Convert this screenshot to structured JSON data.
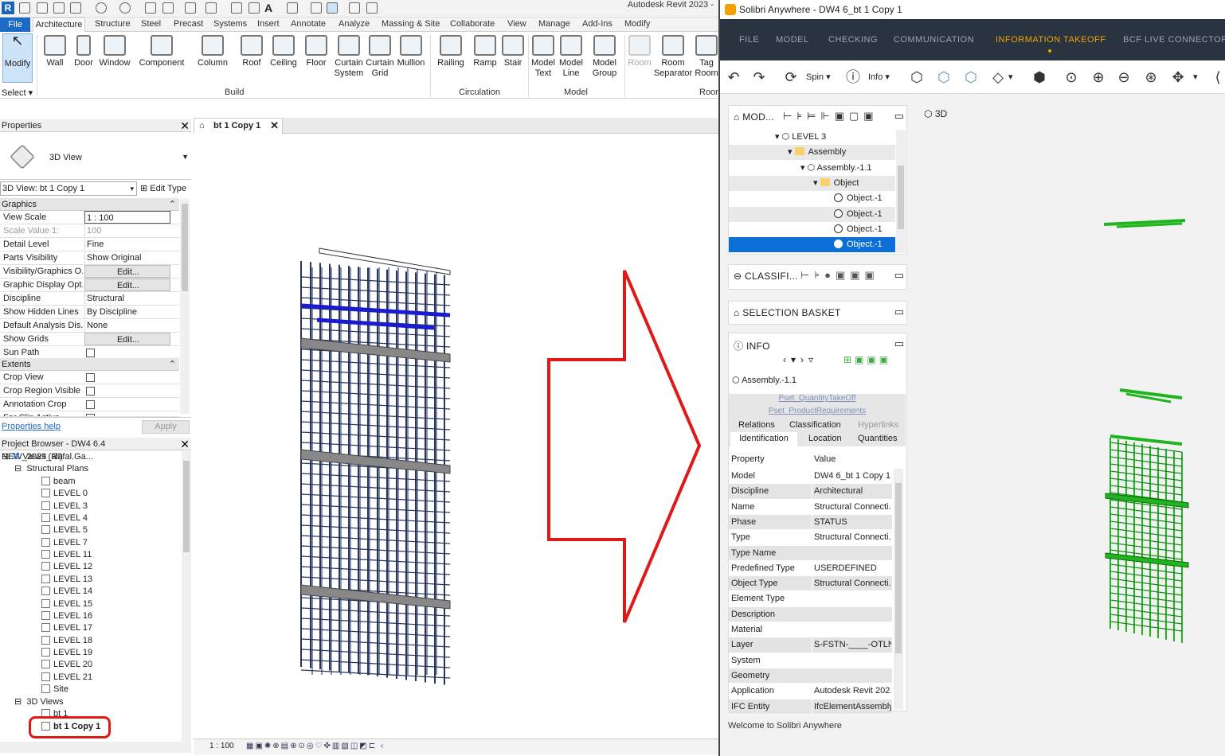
{
  "revit": {
    "title": "Autodesk Revit 2023 -",
    "tabs": [
      "File",
      "Architecture",
      "Structure",
      "Steel",
      "Precast",
      "Systems",
      "Insert",
      "Annotate",
      "Analyze",
      "Massing & Site",
      "Collaborate",
      "View",
      "Manage",
      "Add-Ins",
      "Modify"
    ],
    "ribbon": {
      "modify": "Modify",
      "select": "Select",
      "build": [
        "Wall",
        "Door",
        "Window",
        "Component",
        "Column",
        "Roof",
        "Ceiling",
        "Floor",
        "Curtain System",
        "Curtain Grid",
        "Mullion"
      ],
      "circulation": [
        "Railing",
        "Ramp",
        "Stair"
      ],
      "model": [
        "Model Text",
        "Model Line",
        "Model Group"
      ],
      "room": [
        "Room",
        "Room Separator",
        "Tag Room"
      ],
      "panels": {
        "build": "Build",
        "circulation": "Circulation",
        "model": "Model",
        "room": "Room"
      }
    },
    "properties": {
      "header": "Properties",
      "type": "3D View",
      "view_selector": "3D View: bt 1 Copy 1",
      "edit_type": "Edit Type",
      "group_graphics": "Graphics",
      "rows": [
        {
          "k": "View Scale",
          "v": "1 : 100"
        },
        {
          "k": "Scale Value    1:",
          "v": "100"
        },
        {
          "k": "Detail Level",
          "v": "Fine"
        },
        {
          "k": "Parts Visibility",
          "v": "Show Original"
        },
        {
          "k": "Visibility/Graphics O...",
          "v": "Edit..."
        },
        {
          "k": "Graphic Display Opt...",
          "v": "Edit..."
        },
        {
          "k": "Discipline",
          "v": "Structural"
        },
        {
          "k": "Show Hidden Lines",
          "v": "By Discipline"
        },
        {
          "k": "Default Analysis Dis...",
          "v": "None"
        },
        {
          "k": "Show Grids",
          "v": "Edit..."
        },
        {
          "k": "Sun Path",
          "v": ""
        }
      ],
      "group_extents": "Extents",
      "extent_rows": [
        {
          "k": "Crop View"
        },
        {
          "k": "Crop Region Visible"
        },
        {
          "k": "Annotation Crop"
        },
        {
          "k": "Far Clip Active"
        }
      ],
      "help": "Properties help",
      "apply": "Apply"
    },
    "browser": {
      "header": "Project Browser - DW4 6.4 NEW_2023_Rafal.Ga...",
      "views_all": "Views (all)",
      "structural_plans": "Structural Plans",
      "plans": [
        "beam",
        "LEVEL 0",
        "LEVEL 3",
        "LEVEL 4",
        "LEVEL 5",
        "LEVEL 7",
        "LEVEL 11",
        "LEVEL 12",
        "LEVEL 13",
        "LEVEL 14",
        "LEVEL 15",
        "LEVEL 16",
        "LEVEL 17",
        "LEVEL 18",
        "LEVEL 19",
        "LEVEL 20",
        "LEVEL 21",
        "Site"
      ],
      "views_3d": "3D Views",
      "v3d": [
        "bt 1",
        "bt 1 Copy 1"
      ]
    },
    "view_tab": "bt 1 Copy 1",
    "scale": "1 : 100"
  },
  "solibri": {
    "title": "Solibri Anywhere - DW4 6_bt 1 Copy 1",
    "nav": [
      "FILE",
      "MODEL",
      "CHECKING",
      "COMMUNICATION",
      "INFORMATION TAKEOFF",
      "BCF LIVE CONNECTOR"
    ],
    "tools": {
      "spin": "Spin",
      "info": "Info"
    },
    "model_panel": {
      "title": "MOD...",
      "tree": [
        {
          "label": "LEVEL 3"
        },
        {
          "label": "Assembly"
        },
        {
          "label": "Assembly.-1.1"
        },
        {
          "label": "Object"
        },
        {
          "label": "Object.-1"
        },
        {
          "label": "Object.-1"
        },
        {
          "label": "Object.-1"
        },
        {
          "label": "Object.-1"
        }
      ]
    },
    "class_panel": "CLASSIFI...",
    "basket_panel": "SELECTION BASKET",
    "info_panel": {
      "title": "INFO",
      "selected": "Assembly.-1.1",
      "tabs_row1": [
        "Pset_QuantityTakeOff"
      ],
      "tabs_row2": [
        "Pset_ProductRequirements"
      ],
      "tabs_row3": [
        "Relations",
        "Classification",
        "Hyperlinks"
      ],
      "tabs_row4": [
        "Identification",
        "Location",
        "Quantities"
      ],
      "col_property": "Property",
      "col_value": "Value",
      "rows": [
        {
          "k": "Model",
          "v": "DW4 6_bt 1 Copy 1"
        },
        {
          "k": "Discipline",
          "v": "Architectural"
        },
        {
          "k": "Name",
          "v": "Structural Connecti..."
        },
        {
          "k": "Phase",
          "v": "STATUS"
        },
        {
          "k": "Type",
          "v": "Structural Connecti..."
        },
        {
          "k": "Type Name",
          "v": ""
        },
        {
          "k": "Predefined Type",
          "v": "USERDEFINED"
        },
        {
          "k": "Object Type",
          "v": "Structural Connecti..."
        },
        {
          "k": "Element Type",
          "v": ""
        },
        {
          "k": "Description",
          "v": ""
        },
        {
          "k": "Material",
          "v": ""
        },
        {
          "k": "Layer",
          "v": "S-FSTN-____-OTLN"
        },
        {
          "k": "System",
          "v": ""
        },
        {
          "k": "Geometry",
          "v": ""
        },
        {
          "k": "Application",
          "v": "Autodesk Revit 202..."
        },
        {
          "k": "IFC Entity",
          "v": "IfcElementAssembly"
        }
      ]
    },
    "view_label": "3D",
    "status": "Welcome to Solibri Anywhere"
  },
  "colors": {
    "revit_blue": "#1d69c6",
    "solibri_nav": "#2a3441",
    "accent": "#f0a500",
    "arrow": "#e01818",
    "rebar_green": "#1fb51f",
    "rebar_blue": "#27355c",
    "selection": "#0b6fd6"
  }
}
